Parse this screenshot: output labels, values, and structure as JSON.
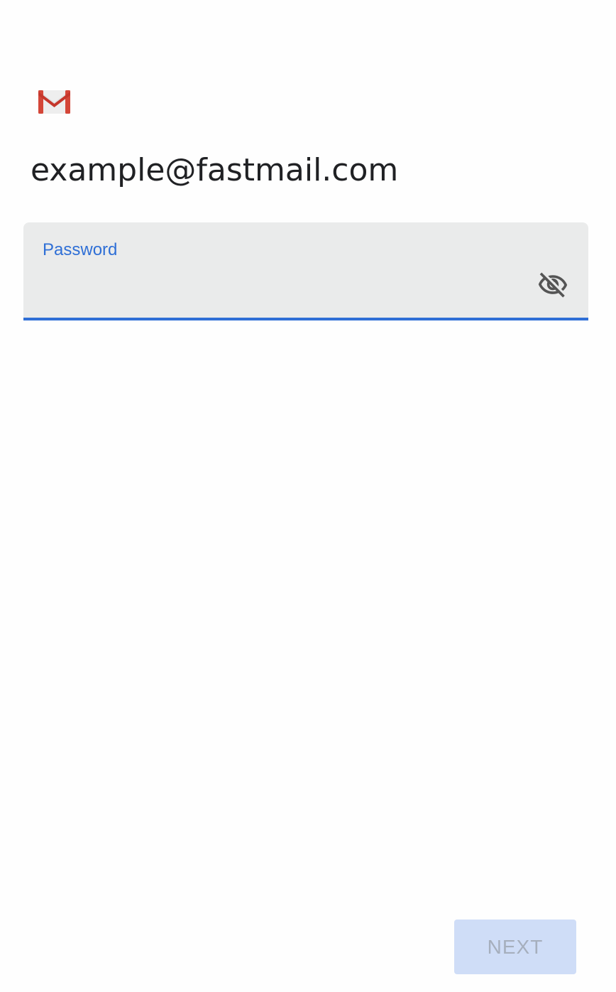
{
  "header": {
    "logo_icon": "gmail-logo-icon",
    "account_email": "example@fastmail.com"
  },
  "password_field": {
    "label": "Password",
    "value": "",
    "visibility_icon": "visibility-off-icon",
    "accent_color": "#2f6fd6"
  },
  "footer": {
    "next_label": "NEXT",
    "next_enabled": false
  }
}
